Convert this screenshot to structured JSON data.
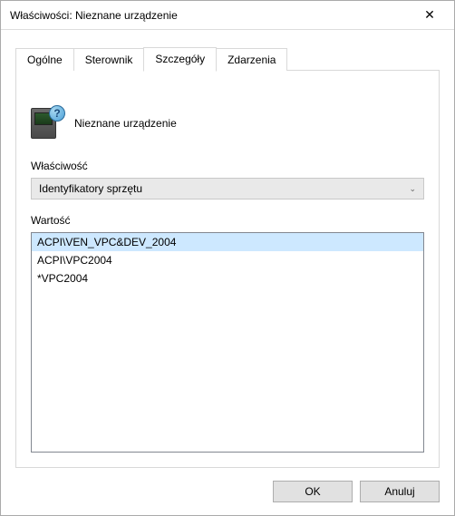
{
  "titlebar": {
    "title": "Właściwości: Nieznane urządzenie"
  },
  "tabs": [
    {
      "label": "Ogólne"
    },
    {
      "label": "Sterownik"
    },
    {
      "label": "Szczegóły"
    },
    {
      "label": "Zdarzenia"
    }
  ],
  "device": {
    "name": "Nieznane urządzenie"
  },
  "property": {
    "label": "Właściwość",
    "selected": "Identyfikatory sprzętu"
  },
  "value": {
    "label": "Wartość",
    "items": [
      "ACPI\\VEN_VPC&DEV_2004",
      "ACPI\\VPC2004",
      "*VPC2004"
    ]
  },
  "buttons": {
    "ok": "OK",
    "cancel": "Anuluj"
  }
}
